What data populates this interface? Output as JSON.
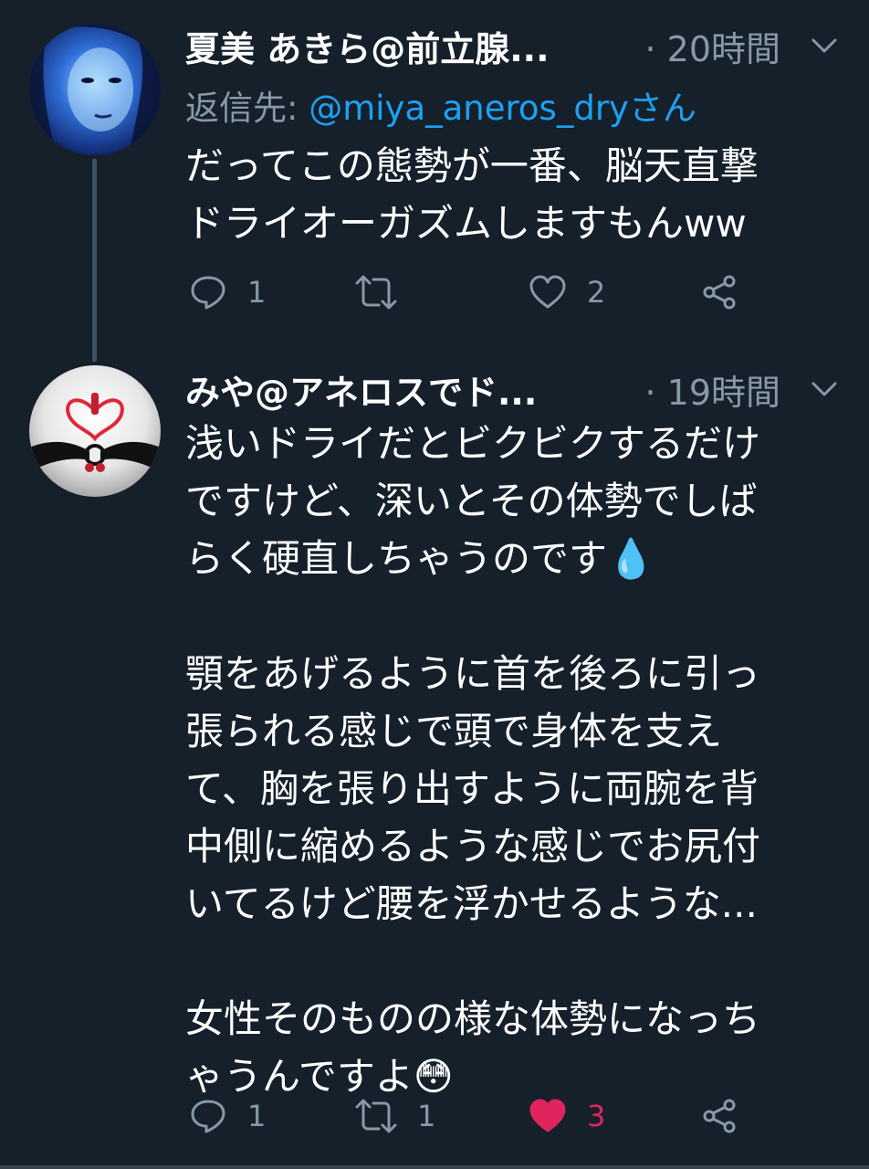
{
  "tweets": [
    {
      "display_name": "夏美 あきら@前立腺...",
      "time": "· 20時間",
      "reply_prefix": "返信先: ",
      "reply_handle": "@miya_aneros_dryさん",
      "text": "だってこの態勢が一番、脳天直撃\nドライオーガズムしますもんww",
      "reply_count": "1",
      "retweet_count": "",
      "like_count": "2",
      "liked": false
    },
    {
      "display_name": "みや@アネロスでド...",
      "time": "· 19時間",
      "text": "浅いドライだとビクビクするだけ\nですけど、深いとその体勢でしば\nらく硬直しちゃうのです💧\n\n顎をあげるように首を後ろに引っ\n張られる感じで頭で身体を支え\nて、胸を張り出すように両腕を背\n中側に縮めるような感じでお尻付\nいてるけど腰を浮かせるような...\n\n女性そのものの様な体勢になっち\nゃうんですよ😳",
      "reply_count": "1",
      "retweet_count": "1",
      "like_count": "3",
      "liked": true
    }
  ],
  "colors": {
    "background": "#15202b",
    "secondary_text": "#8899a6",
    "link": "#1da1f2",
    "like": "#e0245e"
  },
  "icons": [
    "reply-icon",
    "retweet-icon",
    "like-icon",
    "share-icon",
    "chevron-down-icon"
  ]
}
